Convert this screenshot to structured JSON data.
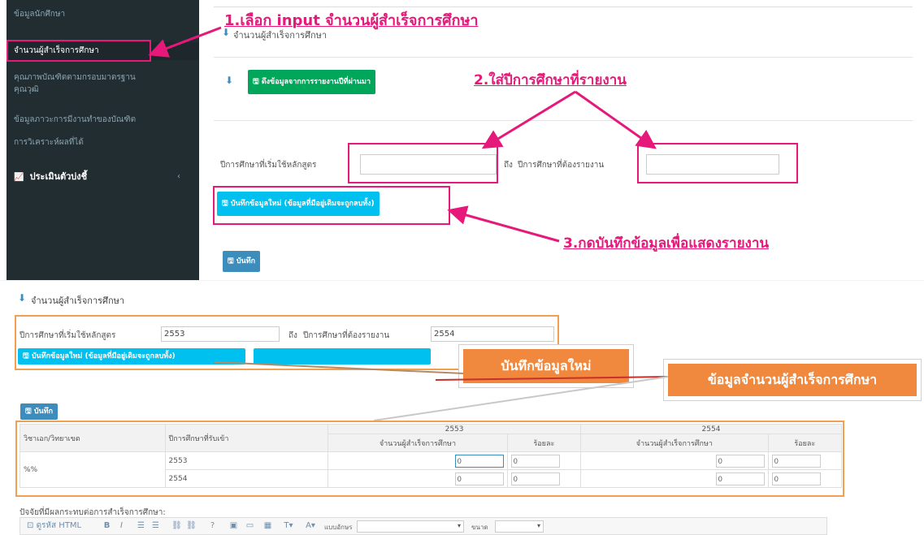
{
  "sidebar": {
    "items": [
      {
        "label": "ข้อมูลนักศึกษา"
      },
      {
        "label": "จำนวนผู้สำเร็จการศึกษา"
      },
      {
        "label": "คุณภาพบัณฑิตตามกรอบมาตรฐาน"
      },
      {
        "label": "คุณวุฒิ"
      },
      {
        "label": "ข้อมูลภาวะการมีงานทำของบัณฑิต"
      },
      {
        "label": "การวิเคราะห์ผลที่ได้"
      }
    ],
    "section": {
      "label": "ประเมินตัวบ่งชี้",
      "chevron": "‹"
    }
  },
  "top": {
    "page_title": "จำนวนผู้สำเร็จการศึกษา",
    "pull_button": "ดึงข้อมูลจากการรายงานปีที่ผ่านมา",
    "start_year_label": "ปีการศึกษาที่เริ่มใช้หลักสูตร",
    "to_label": "ถึง",
    "report_year_label": "ปีการศึกษาที่ต้องรายงาน",
    "start_year_value": "",
    "report_year_value": "",
    "save_new_button": "บันทึกข้อมูลใหม่ (ข้อมูลที่มีอยู่เดิมจะถูกลบทั้ง)",
    "save_button": "บันทึก"
  },
  "annotations": {
    "step1": "1.เลือก input จำนวนผู้สำเร็จการศึกษา",
    "step2": "2.ใส่ปีการศึกษาที่รายงาน",
    "step3": "3.กดบันทึกข้อมูลเพื่อแสดงรายงาน"
  },
  "bottom": {
    "page_title": "จำนวนผู้สำเร็จการศึกษา",
    "start_year_label": "ปีการศึกษาที่เริ่มใช้หลักสูตร",
    "start_year_value": "2553",
    "to_label": "ถึง",
    "report_year_label": "ปีการศึกษาที่ต้องรายงาน",
    "report_year_value": "2554",
    "save_new_button": "บันทึกข้อมูลใหม่ (ข้อมูลที่มีอยู่เดิมจะถูกลบทั้ง)",
    "save_button": "บันทึก",
    "callout_new": "บันทึกข้อมูลใหม่",
    "callout_data": "ข้อมูลจำนวนผู้สำเร็จการศึกษา",
    "table": {
      "col_major": "วิชาเอก/วิทยาเขต",
      "col_year": "ปีการศึกษาที่รับเข้า",
      "groups": [
        "2553",
        "2554"
      ],
      "sub_count": "จำนวนผู้สำเร็จการศึกษา",
      "sub_percent": "ร้อยละ",
      "major_value": "%%",
      "rows": [
        {
          "year": "2553",
          "c1": "0",
          "p1": "0",
          "c2": "0",
          "p2": "0"
        },
        {
          "year": "2554",
          "c1": "0",
          "p1": "0",
          "c2": "0",
          "p2": "0"
        }
      ]
    },
    "factor_label": "ปัจจัยที่มีผลกระทบต่อการสำเร็จการศึกษา:",
    "editor": {
      "source_label": "ดูรหัส HTML",
      "font_label": "แบบอักษร",
      "size_label": "ขนาด"
    }
  },
  "colors": {
    "sidebar_bg": "#222d32",
    "annotation": "#e6197a",
    "callout": "#f0883d",
    "green_button": "#00a65a",
    "cyan_button": "#00c0ef",
    "blue_button": "#3c8dbc"
  }
}
